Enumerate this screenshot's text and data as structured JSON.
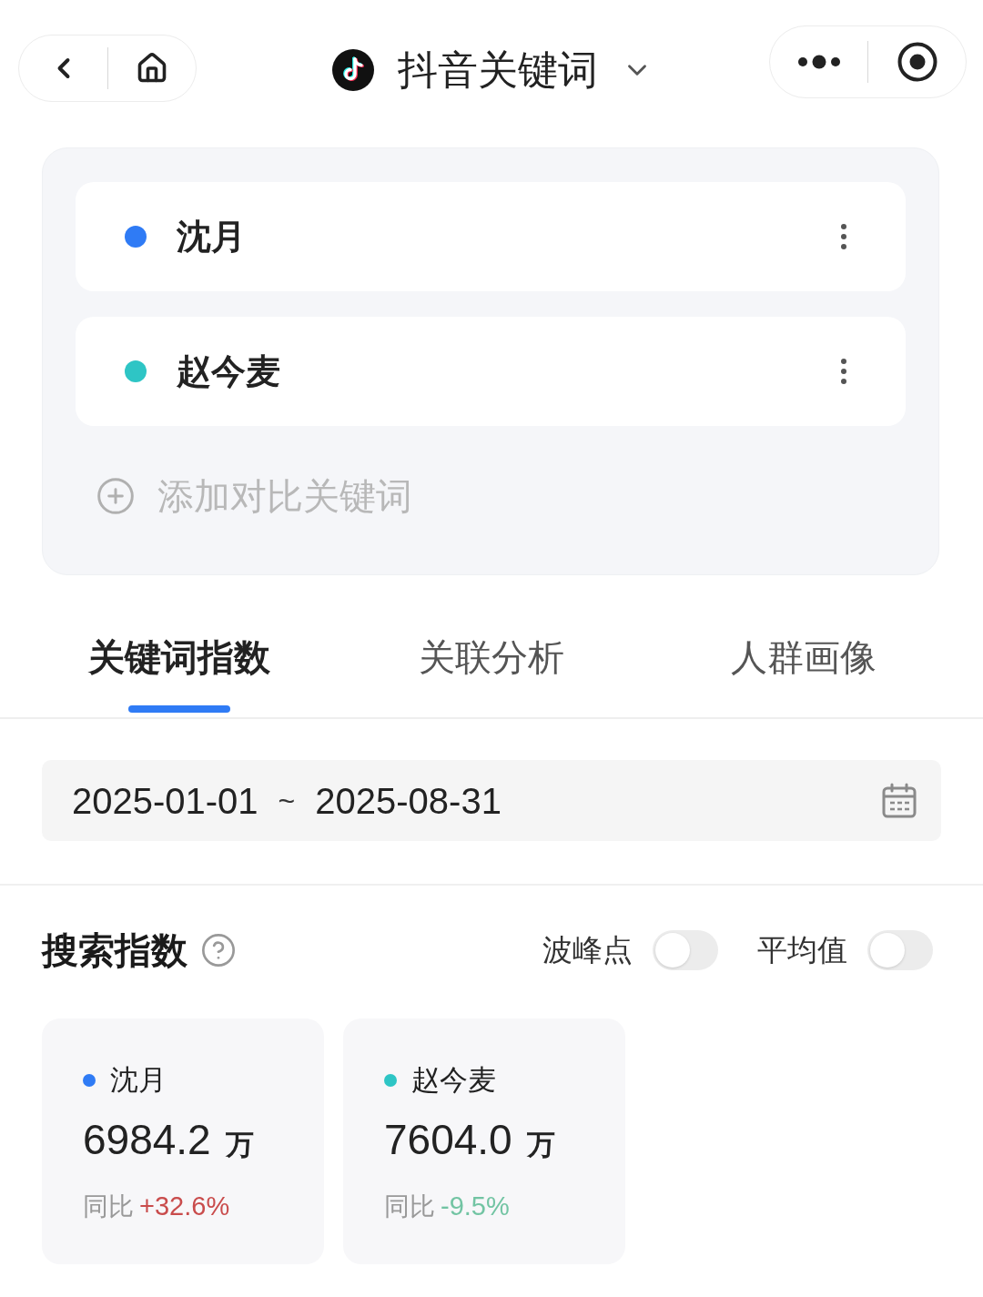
{
  "header": {
    "title": "抖音关键词"
  },
  "keywords": [
    {
      "name": "沈月",
      "color": "#2f7bf5"
    },
    {
      "name": "赵今麦",
      "color": "#2ec5c5"
    }
  ],
  "add_keyword": {
    "label": "添加对比关键词"
  },
  "tabs": [
    {
      "label": "关键词指数",
      "selected": true
    },
    {
      "label": "关联分析",
      "selected": false
    },
    {
      "label": "人群画像",
      "selected": false
    }
  ],
  "date_range": {
    "start": "2025-01-01",
    "separator": "~",
    "end": "2025-08-31"
  },
  "search_index": {
    "title": "搜索指数",
    "toggles": [
      {
        "label": "波峰点",
        "on": false
      },
      {
        "label": "平均值",
        "on": false
      }
    ],
    "cards": [
      {
        "name": "沈月",
        "color": "#2f7bf5",
        "value": "6984.2",
        "unit": "万",
        "yoy_label": "同比",
        "change": "+32.6%",
        "kind": "rise"
      },
      {
        "name": "赵今麦",
        "color": "#2ec5c5",
        "value": "7604.0",
        "unit": "万",
        "yoy_label": "同比",
        "change": "-9.5%",
        "kind": "fall"
      }
    ]
  }
}
